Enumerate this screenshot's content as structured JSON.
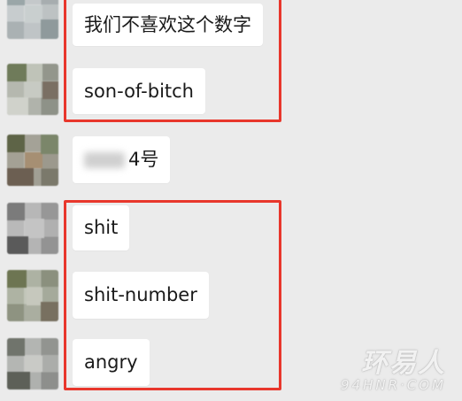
{
  "chat": {
    "messages": [
      {
        "text": "我们不喜欢这个数字"
      },
      {
        "text": "son-of-bitch"
      },
      {
        "text": "4号"
      },
      {
        "text": "shit"
      },
      {
        "text": "shit-number"
      },
      {
        "text": "angry"
      }
    ]
  },
  "watermark": {
    "site_name": "环易人",
    "site_url": "94HNR·COM"
  },
  "colors": {
    "background": "#ebebeb",
    "bubble": "#ffffff",
    "highlight_border": "#e8372c",
    "text": "#1a1a1a"
  }
}
